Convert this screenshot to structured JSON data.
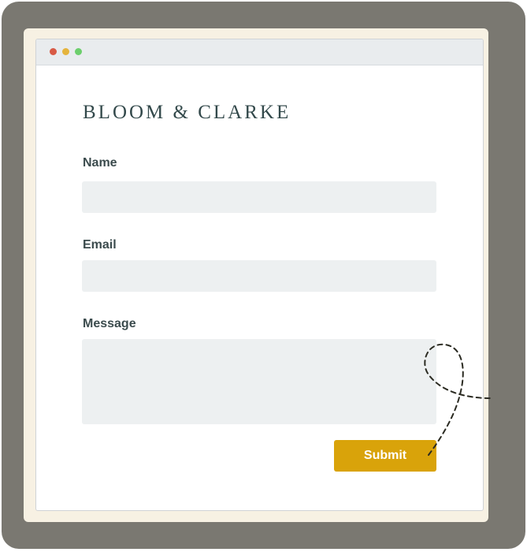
{
  "brand": {
    "name": "BLOOM & CLARKE"
  },
  "form": {
    "fields": [
      {
        "label": "Name",
        "value": "",
        "placeholder": ""
      },
      {
        "label": "Email",
        "value": "",
        "placeholder": ""
      },
      {
        "label": "Message",
        "value": "",
        "placeholder": ""
      }
    ],
    "submit_label": "Submit"
  },
  "colors": {
    "frame": "#7a7871",
    "paper": "#f7f1e3",
    "brand_text": "#33494b",
    "field_bg": "#edf0f1",
    "submit_bg": "#d9a30a",
    "traffic_lights": [
      "#d85a45",
      "#e5b43c",
      "#6ccf6c"
    ]
  }
}
